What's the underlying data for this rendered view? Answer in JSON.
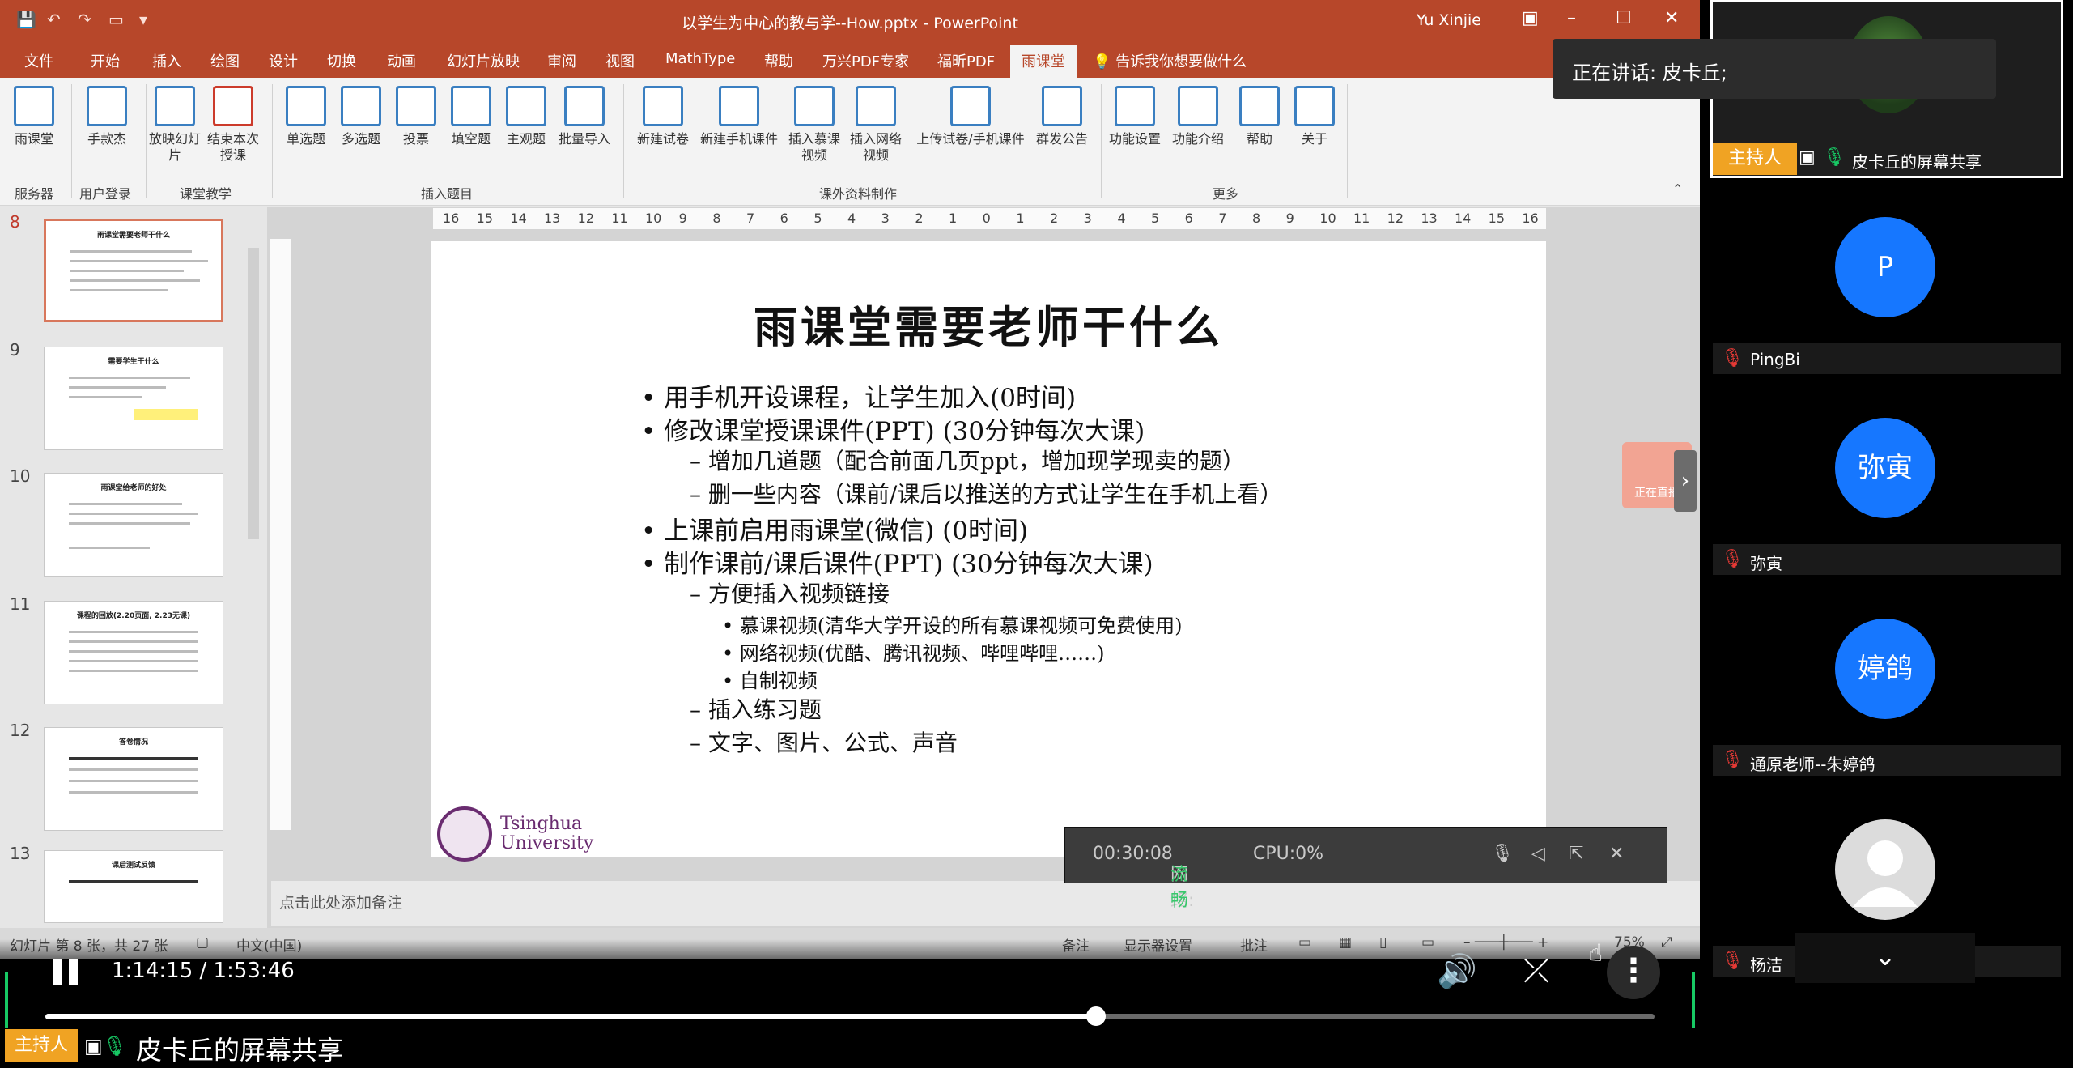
{
  "ppt": {
    "title": "以学生为中心的教与学--How.pptx  -  PowerPoint",
    "user": "Yu Xinjie",
    "tabs": [
      "文件",
      "开始",
      "插入",
      "绘图",
      "设计",
      "切换",
      "动画",
      "幻灯片放映",
      "审阅",
      "视图",
      "MathType",
      "帮助",
      "万兴PDF专家",
      "福昕PDF",
      "雨课堂"
    ],
    "tell_me": "告诉我你想要做什么",
    "ribbon": {
      "buttons": [
        "雨课堂",
        "手款杰",
        "放映幻灯片",
        "结束本次授课",
        "单选题",
        "多选题",
        "投票",
        "填空题",
        "主观题",
        "批量导入",
        "新建试卷",
        "新建手机课件",
        "插入慕课视频",
        "插入网络视频",
        "上传试卷/手机课件",
        "群发公告",
        "功能设置",
        "功能介绍",
        "帮助",
        "关于"
      ],
      "groups": [
        "服务器",
        "用户登录",
        "课堂教学",
        "插入题目",
        "课外资料制作",
        "更多"
      ]
    },
    "thumbs": [
      {
        "num": "8",
        "title": "雨课堂需要老师干什么"
      },
      {
        "num": "9",
        "title": "需要学生干什么"
      },
      {
        "num": "10",
        "title": "雨课堂给老师的好处"
      },
      {
        "num": "11",
        "title": "课程的回放(2.20页面, 2.23无课)"
      },
      {
        "num": "12",
        "title": "答卷情况"
      },
      {
        "num": "13",
        "title": "课后测试反馈"
      }
    ],
    "ruler": [
      "16",
      "15",
      "14",
      "13",
      "12",
      "11",
      "10",
      "9",
      "8",
      "7",
      "6",
      "5",
      "4",
      "3",
      "2",
      "1",
      "0",
      "1",
      "2",
      "3",
      "4",
      "5",
      "6",
      "7",
      "8",
      "9",
      "10",
      "11",
      "12",
      "13",
      "14",
      "15",
      "16"
    ],
    "slide": {
      "title": "雨课堂需要老师干什么",
      "bullets": [
        {
          "level": 1,
          "text": "•  用手机开设课程，让学生加入(0时间)"
        },
        {
          "level": 1,
          "text": "•  修改课堂授课课件(PPT) (30分钟每次大课)"
        },
        {
          "level": 2,
          "text": "–  增加几道题（配合前面几页ppt，增加现学现卖的题）"
        },
        {
          "level": 2,
          "text": "–  删一些内容（课前/课后以推送的方式让学生在手机上看）"
        },
        {
          "level": 1,
          "text": "•  上课前启用雨课堂(微信) (0时间)"
        },
        {
          "level": 1,
          "text": "•  制作课前/课后课件(PPT) (30分钟每次大课)"
        },
        {
          "level": 2,
          "text": "–  方便插入视频链接"
        },
        {
          "level": 3,
          "text": "•  慕课视频(清华大学开设的所有慕课视频可免费使用)"
        },
        {
          "level": 3,
          "text": "•  网络视频(优酷、腾讯视频、哔哩哔哩……)"
        },
        {
          "level": 3,
          "text": "•  自制视频"
        },
        {
          "level": 2,
          "text": "–  插入练习题"
        },
        {
          "level": 2,
          "text": "–  文字、图片、公式、声音"
        }
      ],
      "logo_line1": "Tsinghua",
      "logo_line2": "University"
    },
    "side_tab": "正在直播",
    "notes_placeholder": "点击此处添加备注",
    "status": {
      "slide_info": "幻灯片 第 8 张，共 27 张",
      "language": "中文(中国)",
      "notes": "备注",
      "display": "显示器设置",
      "comments": "批注",
      "zoom": "75%"
    }
  },
  "meeting_overlay": {
    "timer": "00:30:08",
    "network_label": "网络:",
    "network_value": "流畅",
    "cpu": "CPU:0%"
  },
  "player": {
    "time": "1:14:15 / 1:53:46",
    "progress_fraction": 0.6527
  },
  "bottom": {
    "host": "主持人",
    "share_name": "皮卡丘的屏幕共享"
  },
  "panel": {
    "speaking": "正在讲话: 皮卡丘;",
    "host_tag": "主持人",
    "speaker_name": "皮卡丘的屏幕共享",
    "participants": [
      {
        "avatar": "P",
        "name": "PingBi"
      },
      {
        "avatar": "弥寅",
        "name": "弥寅"
      },
      {
        "avatar": "婷鸽",
        "name": "通原老师--朱婷鸽"
      },
      {
        "avatar": "",
        "name": "杨洁"
      }
    ]
  },
  "colors": {
    "ppt_accent": "#b7472a",
    "host_orange": "#f0a323",
    "avatar_blue": "#1677ff",
    "network_good": "#37c86b"
  }
}
